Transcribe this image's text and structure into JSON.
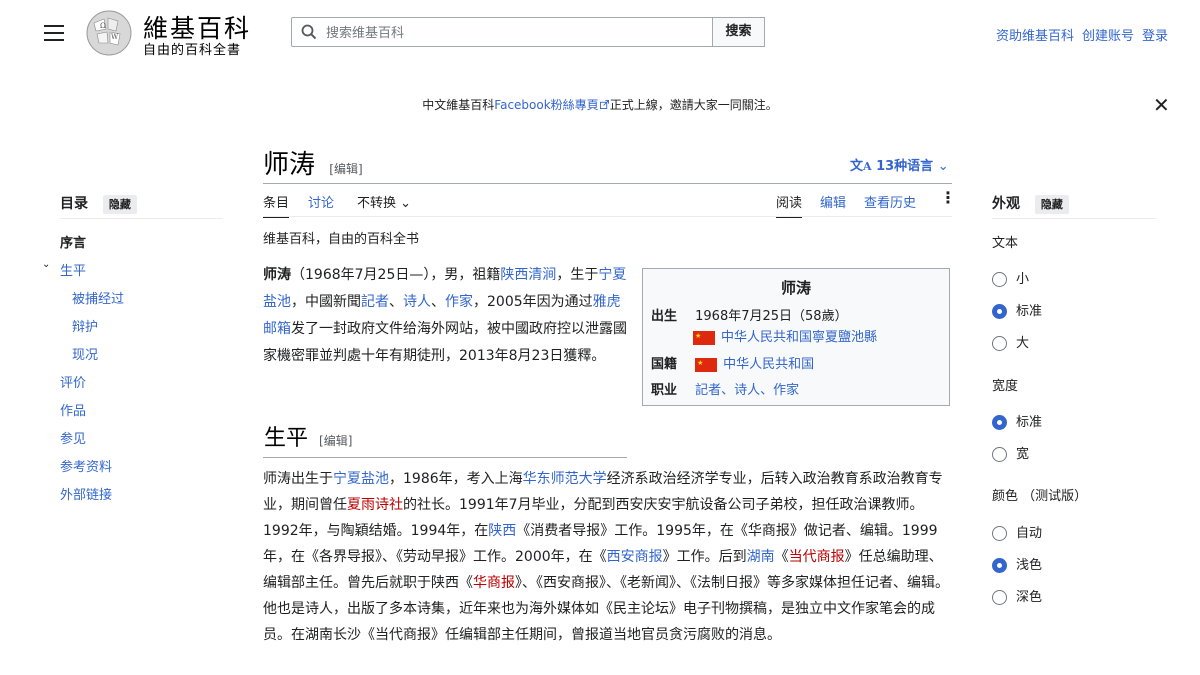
{
  "header": {
    "logo_wordmark": "維基百科",
    "logo_tagline": "自由的百科全書",
    "search_placeholder": "搜索维基百科",
    "search_button": "搜索",
    "links": [
      "资助维基百科",
      "创建账号",
      "登录"
    ]
  },
  "banner": {
    "before": "中文維基百科",
    "link": "Facebook粉絲專頁",
    "after": "正式上線，邀請大家一同關注。"
  },
  "toc": {
    "title": "目录",
    "hide": "隐藏",
    "items": [
      "序言",
      "生平",
      "被捕经过",
      "辩护",
      "现况",
      "评价",
      "作品",
      "参见",
      "参考资料",
      "外部链接"
    ]
  },
  "article": {
    "title": "师涛",
    "edit": "[编辑]",
    "languages": "13种语言",
    "tabs_left": [
      "条目",
      "讨论",
      "不转换"
    ],
    "tabs_right": [
      "阅读",
      "编辑",
      "查看历史"
    ],
    "from": "维基百科，自由的百科全书",
    "section_title": "生平",
    "section_edit": "[编辑]"
  },
  "infobox": {
    "title": "师涛",
    "born_label": "出生",
    "born_date": "1968年7月25日（58歲）",
    "born_place": "中华人民共和国寧夏鹽池縣",
    "nationality_label": "国籍",
    "nationality": "中华人民共和国",
    "occupation_label": "职业",
    "occupation": "記者、诗人、作家"
  },
  "appearance": {
    "title": "外观",
    "hide": "隐藏",
    "text_label": "文本",
    "text_options": [
      "小",
      "标准",
      "大"
    ],
    "width_label": "宽度",
    "width_options": [
      "标准",
      "宽"
    ],
    "color_label": "颜色 （测试版）",
    "color_options": [
      "自动",
      "浅色",
      "深色"
    ],
    "selected": {
      "text": "标准",
      "width": "标准",
      "color": "浅色"
    }
  }
}
